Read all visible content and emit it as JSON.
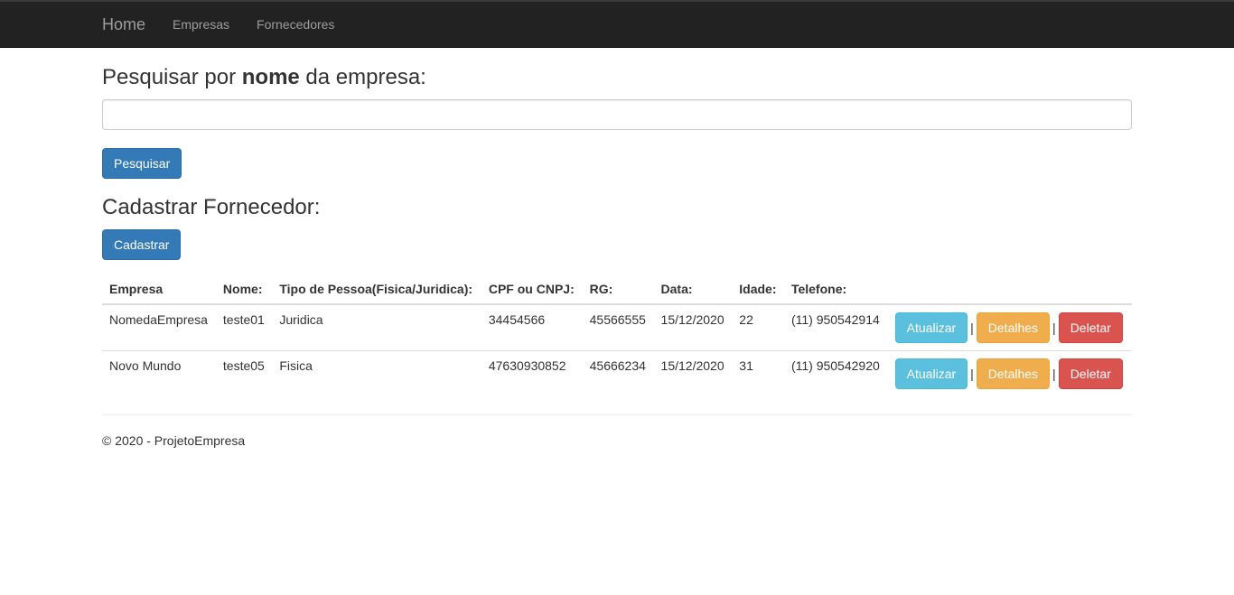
{
  "nav": {
    "brand": "Home",
    "links": [
      "Empresas",
      "Fornecedores"
    ]
  },
  "search": {
    "title_prefix": "Pesquisar por ",
    "title_bold": "nome",
    "title_suffix": " da empresa:",
    "value": "",
    "placeholder": "",
    "button": "Pesquisar"
  },
  "register": {
    "title": "Cadastrar Fornecedor:",
    "button": "Cadastrar"
  },
  "table": {
    "headers": [
      "Empresa",
      "Nome:",
      "Tipo de Pessoa(Fisica/Juridica):",
      "CPF ou CNPJ:",
      "RG:",
      "Data:",
      "Idade:",
      "Telefone:"
    ],
    "rows": [
      {
        "empresa": "NomedaEmpresa",
        "nome": "teste01",
        "tipo": "Juridica",
        "doc": "34454566",
        "rg": "45566555",
        "data": "15/12/2020",
        "idade": "22",
        "telefone": "(11) 950542914"
      },
      {
        "empresa": "Novo Mundo",
        "nome": "teste05",
        "tipo": "Fisica",
        "doc": "47630930852",
        "rg": "45666234",
        "data": "15/12/2020",
        "idade": "31",
        "telefone": "(11) 950542920"
      }
    ],
    "actions": {
      "update": "Atualizar",
      "details": "Detalhes",
      "delete": "Deletar",
      "separator": "|"
    }
  },
  "footer": {
    "text": "© 2020 - ProjetoEmpresa"
  }
}
